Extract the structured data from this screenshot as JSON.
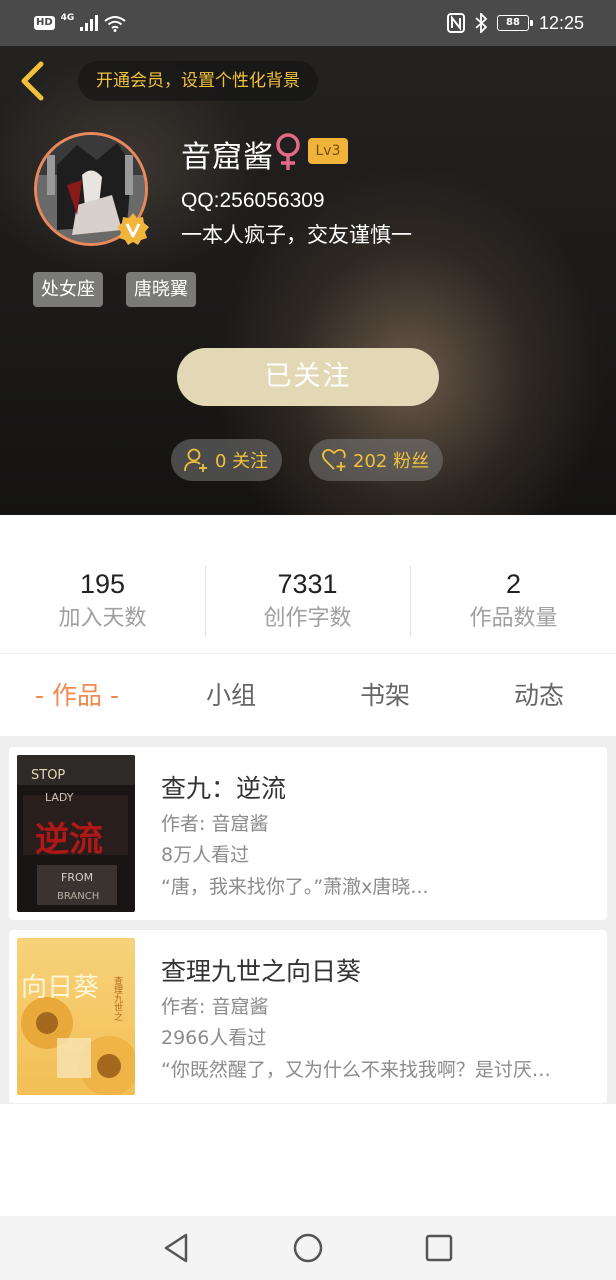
{
  "status_bar": {
    "hd": "HD",
    "network": "4G",
    "battery": "88",
    "time": "12:25"
  },
  "header": {
    "vip_prompt": "开通会员，设置个性化背景",
    "username": "音窟酱",
    "gender_symbol": "♀",
    "level": "Lv3",
    "qq": "QQ:256056309",
    "signature": "一本人疯子，交友谨慎一",
    "tags": [
      "处女座",
      "唐晓翼"
    ],
    "follow_button": "已关注",
    "following_label": "0 关注",
    "fans_label": "202 粉丝",
    "accent_color": "#f0c23a",
    "avatar_ring_color": "#e9885a",
    "badge_color": "#f0b43a"
  },
  "stats": [
    {
      "value": "195",
      "label": "加入天数"
    },
    {
      "value": "7331",
      "label": "创作字数"
    },
    {
      "value": "2",
      "label": "作品数量"
    }
  ],
  "tabs": [
    {
      "label": "- 作品 -",
      "active": true
    },
    {
      "label": "小组",
      "active": false
    },
    {
      "label": "书架",
      "active": false
    },
    {
      "label": "动态",
      "active": false
    }
  ],
  "works": [
    {
      "title": "查九：逆流",
      "author": "作者: 音窟酱",
      "views": "8万人看过",
      "description": "“唐，我来找你了。”萧澈x唐晓...",
      "cover_text": [
        "STOP",
        "LADY",
        "逆流",
        "FROM",
        "BRANCH"
      ]
    },
    {
      "title": "查理九世之向日葵",
      "author": "作者: 音窟酱",
      "views": "2966人看过",
      "description": "“你既然醒了，又为什么不来找我啊？是讨厌…",
      "cover_text": [
        "向日葵",
        "查理九世之"
      ]
    }
  ],
  "icons": {
    "back": "chevron-left-icon",
    "v_badge": "verified-v-icon",
    "female": "female-icon",
    "following": "user-add-icon",
    "fans": "heart-add-icon",
    "nav_back": "triangle-back-icon",
    "nav_home": "circle-home-icon",
    "nav_recent": "square-recent-icon"
  }
}
